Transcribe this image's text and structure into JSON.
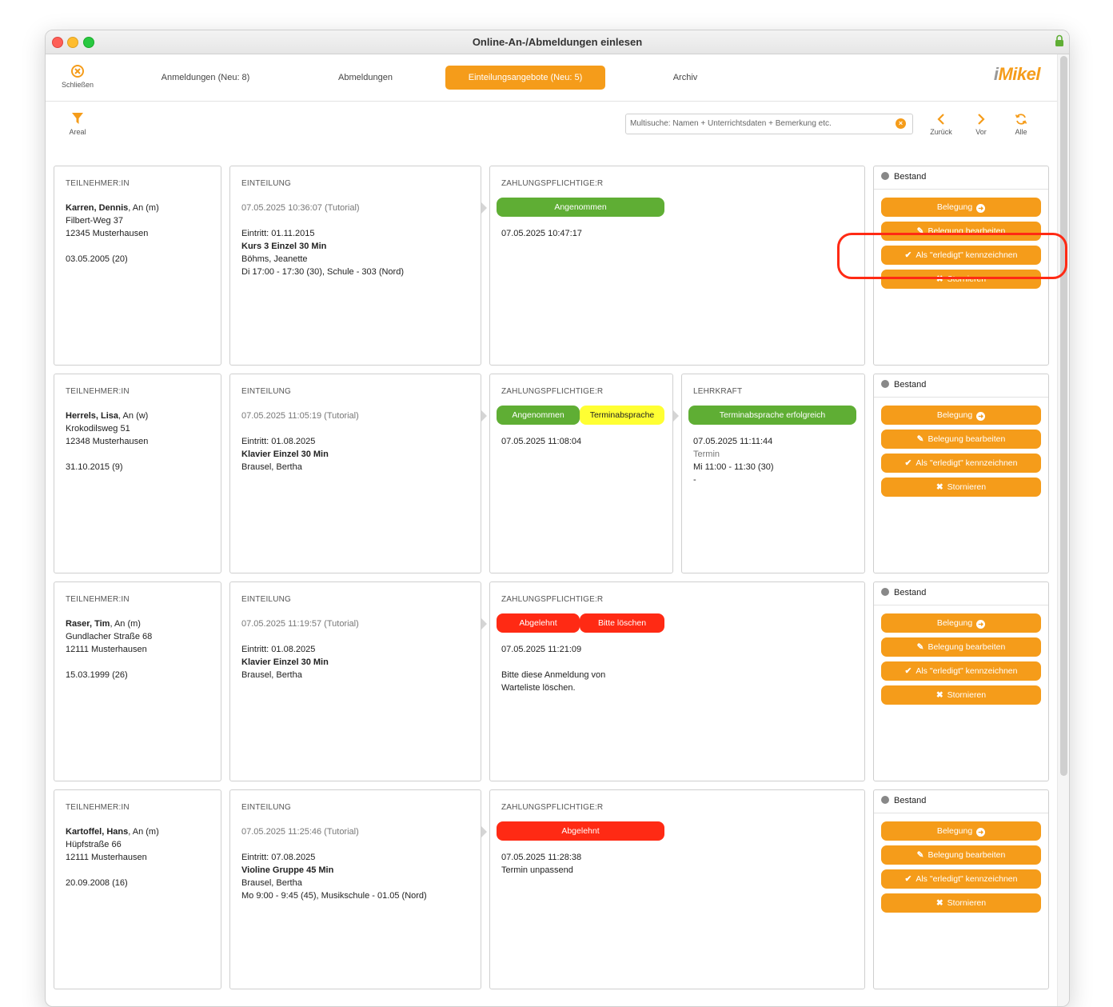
{
  "window": {
    "title": "Online-An-/Abmeldungen einlesen"
  },
  "toolbar": {
    "close_label": "Schließen",
    "tabs": [
      {
        "label": "Anmeldungen (Neu: 8)"
      },
      {
        "label": "Abmeldungen"
      },
      {
        "label": "Einteilungsangebote (Neu: 5)"
      },
      {
        "label": "Archiv"
      }
    ],
    "logo_i": "i",
    "logo_rest": "Mikel",
    "filter_label": "Areal"
  },
  "search": {
    "placeholder": "Multisuche: Namen + Unterrichtsdaten + Bemerkung etc."
  },
  "nav": {
    "back": "Zurück",
    "forward": "Vor",
    "all": "Alle"
  },
  "headers": {
    "participant": "TEILNEHMER:IN",
    "assignment": "EINTEILUNG",
    "payer": "ZAHLUNGSPFLICHTIGE:R",
    "teacher": "LEHRKRAFT"
  },
  "actions": {
    "bestand": "Bestand",
    "belegung": "Belegung",
    "bearbeiten": "Belegung bearbeiten",
    "erledigt": "Als \"erledigt\" kennzeichnen",
    "stornieren": "Stornieren"
  },
  "rows": [
    {
      "participant": {
        "name": "Karren, Dennis",
        "suffix": ", An (m)",
        "street": "Filbert-Weg 37",
        "city": "12345 Musterhausen",
        "birth": "03.05.2005 (20)"
      },
      "assignment": {
        "timestamp": "07.05.2025 10:36:07 (Tutorial)",
        "entry": "Eintritt: 01.11.2015",
        "course": "Kurs 3 Einzel 30 Min",
        "teacher": "Böhms, Jeanette",
        "schedule": "Di 17:00 - 17:30 (30), Schule - 303 (Nord)"
      },
      "payer": {
        "status1": "Angenommen",
        "time": "07.05.2025 10:47:17"
      }
    },
    {
      "participant": {
        "name": "Herrels, Lisa",
        "suffix": ", An (w)",
        "street": "Krokodilsweg 51",
        "city": "12348 Musterhausen",
        "birth": "31.10.2015 (9)"
      },
      "assignment": {
        "timestamp": "07.05.2025 11:05:19 (Tutorial)",
        "entry": "Eintritt: 01.08.2025",
        "course": "Klavier Einzel 30 Min",
        "teacher": "Brausel, Bertha"
      },
      "payer": {
        "status1": "Angenommen",
        "status2": "Terminabsprache",
        "time": "07.05.2025 11:08:04"
      },
      "teacher": {
        "status": "Terminabsprache erfolgreich",
        "time": "07.05.2025 11:11:44",
        "label": "Termin",
        "slot": "Mi 11:00 - 11:30 (30)",
        "dash": "-"
      }
    },
    {
      "participant": {
        "name": "Raser, Tim",
        "suffix": ", An (m)",
        "street": "Gundlacher Straße 68",
        "city": "12111 Musterhausen",
        "birth": "15.03.1999 (26)"
      },
      "assignment": {
        "timestamp": "07.05.2025 11:19:57 (Tutorial)",
        "entry": "Eintritt: 01.08.2025",
        "course": "Klavier Einzel 30 Min",
        "teacher": "Brausel, Bertha"
      },
      "payer": {
        "status1": "Abgelehnt",
        "status2": "Bitte löschen",
        "time": "07.05.2025 11:21:09",
        "note1": "Bitte diese Anmeldung von",
        "note2": "Warteliste löschen."
      }
    },
    {
      "participant": {
        "name": "Kartoffel, Hans",
        "suffix": ", An (m)",
        "street": "Hüpfstraße 66",
        "city": "12111 Musterhausen",
        "birth": "20.09.2008 (16)"
      },
      "assignment": {
        "timestamp": "07.05.2025 11:25:46 (Tutorial)",
        "entry": "Eintritt: 07.08.2025",
        "course": "Violine Gruppe 45 Min",
        "teacher": "Brausel, Bertha",
        "schedule": "Mo 9:00 - 9:45 (45), Musikschule - 01.05 (Nord)"
      },
      "payer": {
        "status1": "Abgelehnt",
        "time": "07.05.2025 11:28:38",
        "note1": "Termin unpassend"
      }
    }
  ],
  "colors": {
    "accent": "#f59c1a",
    "green": "#5fae34",
    "yellow": "#ffff33",
    "red": "#ff2a14"
  }
}
